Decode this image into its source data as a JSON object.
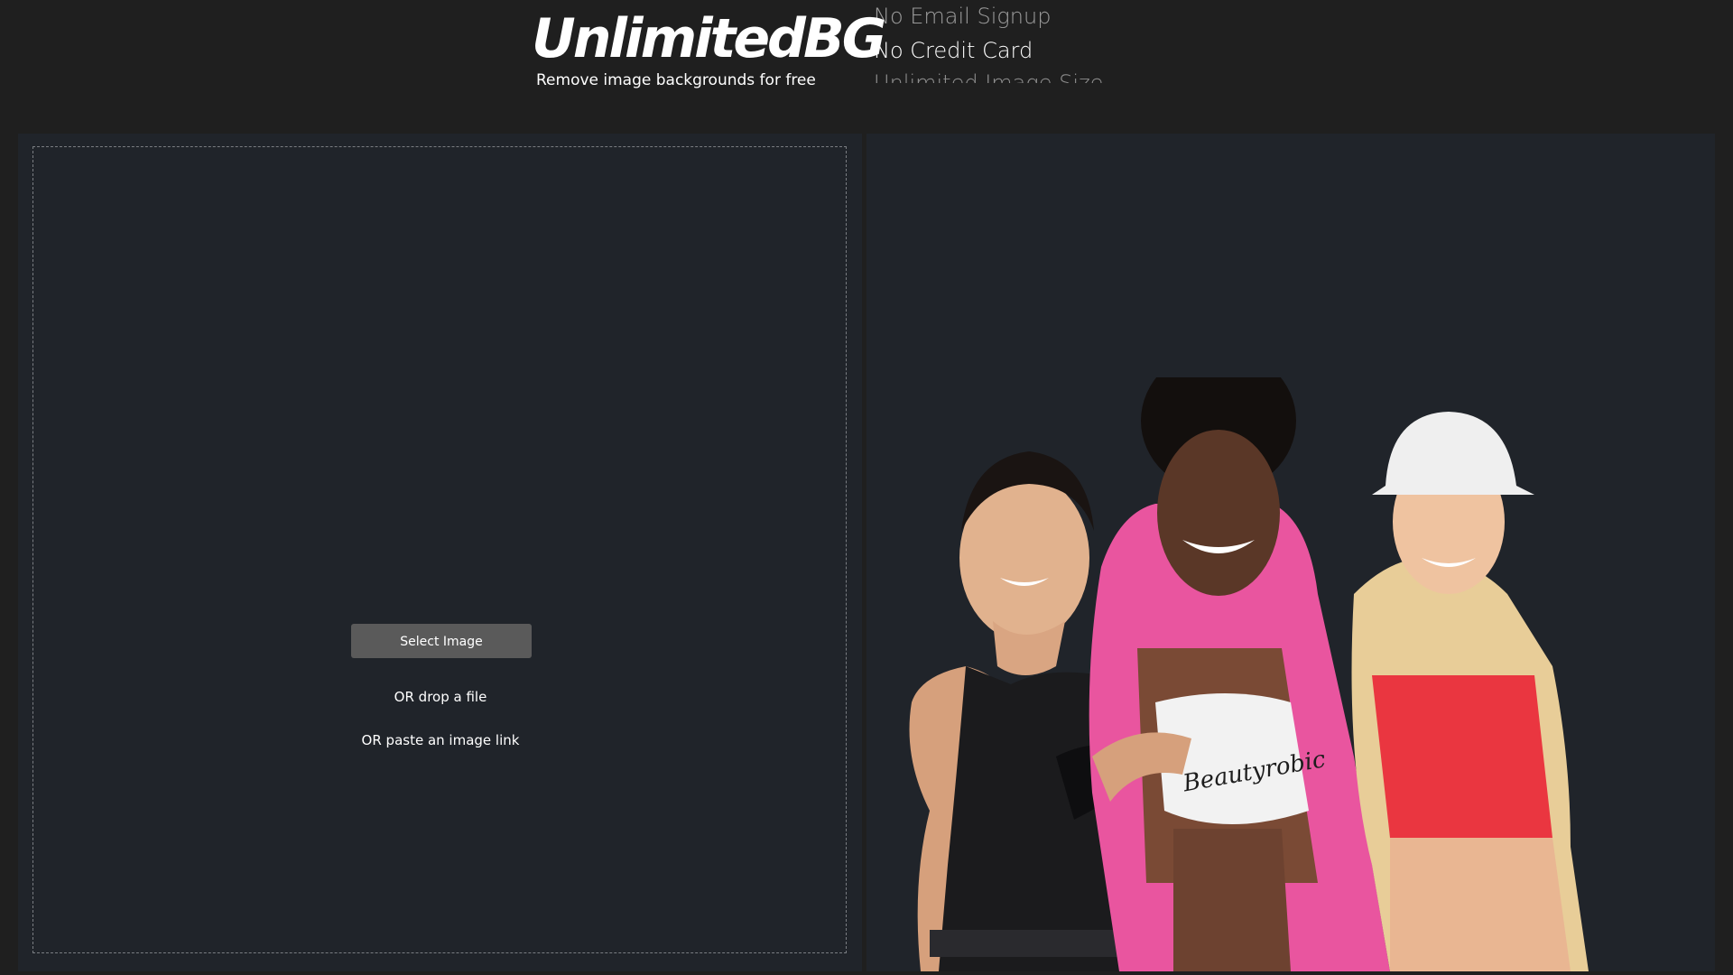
{
  "header": {
    "logo": "UnlimitedBG",
    "tagline": "Remove image backgrounds for free",
    "features": [
      "No Email Signup",
      "No Credit Card",
      "Unlimited Image Size"
    ]
  },
  "upload": {
    "select_label": "Select Image",
    "drop_text": "OR drop a file",
    "paste_text": "OR paste an image link"
  },
  "preview": {
    "description": "Example result image",
    "shirt_brand": "Beautyrobic"
  },
  "colors": {
    "page_bg": "#1f1f1f",
    "panel_bg": "#20242a",
    "button_bg": "#5a5a5a",
    "pink": "#e9559f",
    "red": "#ea3640"
  }
}
